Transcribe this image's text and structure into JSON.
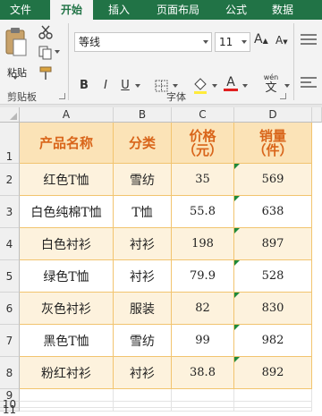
{
  "ribbon": {
    "tabs": [
      "文件",
      "开始",
      "插入",
      "页面布局",
      "公式",
      "数据"
    ],
    "active_tab": "开始",
    "clipboard": {
      "paste_label": "粘贴",
      "group_label": "剪贴板"
    },
    "font": {
      "group_label": "字体",
      "font_name": "等线",
      "font_size": "11",
      "grow_label": "A",
      "shrink_label": "A",
      "bold": "B",
      "italic": "I",
      "underline": "U",
      "font_color_label": "A",
      "wen_label": "wén",
      "wen_char": "文"
    }
  },
  "sheet": {
    "columns": [
      "A",
      "B",
      "C",
      "D"
    ],
    "rows": [
      "1",
      "2",
      "3",
      "4",
      "5",
      "6",
      "7",
      "8",
      "9",
      "10",
      "11"
    ],
    "header": [
      "产品名称",
      "分类",
      "价格\n（元）",
      "销量\n（件）"
    ],
    "data": [
      [
        "红色T恤",
        "雪纺",
        "35",
        "569"
      ],
      [
        "白色纯棉T恤",
        "T恤",
        "55.8",
        "638"
      ],
      [
        "白色衬衫",
        "衬衫",
        "198",
        "897"
      ],
      [
        "绿色T恤",
        "衬衫",
        "79.9",
        "528"
      ],
      [
        "灰色衬衫",
        "服装",
        "82",
        "830"
      ],
      [
        "黑色T恤",
        "雪纺",
        "99",
        "982"
      ],
      [
        "粉红衬衫",
        "衬衫",
        "38.8",
        "892"
      ]
    ]
  },
  "colors": {
    "accent": "#217346",
    "header_fill": "#fbe3b7",
    "header_text": "#d9651a",
    "band_fill": "#fdf2dd",
    "border": "#f2c46f"
  }
}
